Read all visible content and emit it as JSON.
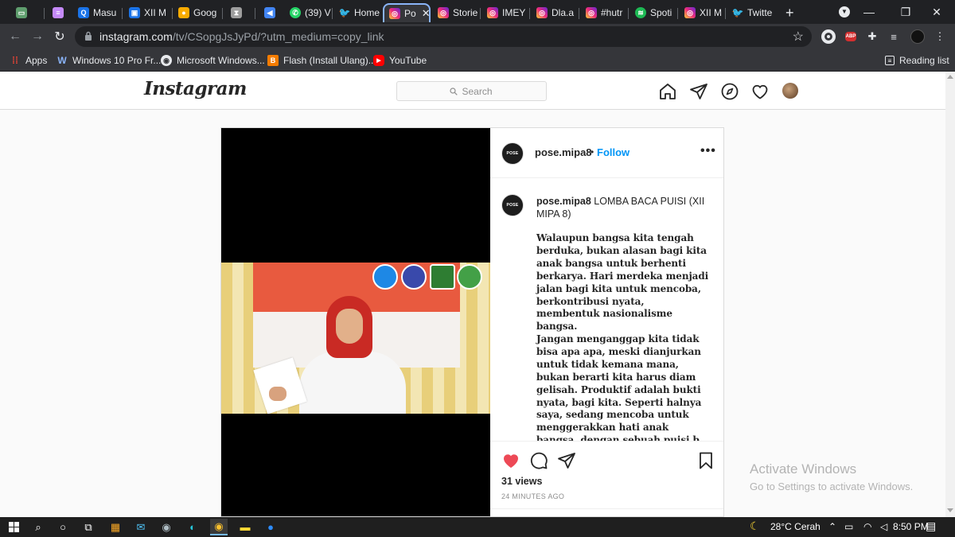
{
  "browser": {
    "tabs": [
      {
        "title": "",
        "icon": "terminal-icon",
        "color": "#5f9e6e"
      },
      {
        "title": "",
        "icon": "notes-icon",
        "color": "#c58af9"
      },
      {
        "title": "Masu",
        "icon": "q-icon",
        "color": "#1a73e8"
      },
      {
        "title": "XII M",
        "icon": "classroom-icon",
        "color": "#1a73e8"
      },
      {
        "title": "Goog",
        "icon": "keep-icon",
        "color": "#f9ab00"
      },
      {
        "title": "",
        "icon": "hourglass-icon",
        "color": "#9e9e9e"
      },
      {
        "title": "",
        "icon": "megaphone-icon",
        "color": "#4285f4"
      },
      {
        "title": "(39) V",
        "icon": "whatsapp-icon",
        "color": "#25d366"
      },
      {
        "title": "Home",
        "icon": "twitter-icon",
        "color": "#1d9bf0"
      },
      {
        "title": "Po",
        "icon": "instagram-icon",
        "color": "#e1306c",
        "active": true
      },
      {
        "title": "Storie",
        "icon": "instagram-icon",
        "color": "#e1306c"
      },
      {
        "title": "IMEY",
        "icon": "instagram-icon",
        "color": "#e1306c"
      },
      {
        "title": "Dla.a",
        "icon": "instagram-icon",
        "color": "#e1306c"
      },
      {
        "title": "#hutr",
        "icon": "instagram-icon",
        "color": "#e1306c"
      },
      {
        "title": "Spoti",
        "icon": "spotify-icon",
        "color": "#1db954"
      },
      {
        "title": "XII M",
        "icon": "instagram-icon",
        "color": "#e1306c"
      },
      {
        "title": "Twitte",
        "icon": "twitter-icon",
        "color": "#1d9bf0"
      }
    ],
    "new_tab": "+",
    "url_host": "instagram.com",
    "url_path": "/tv/CSopgJsJyPd/?utm_medium=copy_link",
    "abp_label": "ABP"
  },
  "bookmarks": [
    {
      "label": "Apps",
      "icon": "apps-grid-icon",
      "color": "#ea4335"
    },
    {
      "label": "Windows 10 Pro Fr...",
      "icon": "w-icon",
      "color": "#3b5998"
    },
    {
      "label": "Microsoft Windows...",
      "icon": "globe-icon",
      "color": "#e8eaed"
    },
    {
      "label": "Flash (Install Ulang)...",
      "icon": "blogger-icon",
      "color": "#f57c00"
    },
    {
      "label": "YouTube",
      "icon": "youtube-icon",
      "color": "#ff0000"
    }
  ],
  "reading_list": "Reading list",
  "instagram": {
    "logo": "Instagram",
    "search_placeholder": "Search",
    "post": {
      "username": "pose.mipa8",
      "follow": "Follow",
      "dot": "•",
      "avatar_text": "POSE",
      "caption_title": "LOMBA BACA PUISI (XII MIPA 8)",
      "paragraph1": "Walaupun bangsa kita tengah berduka, bukan alasan bagi kita anak bangsa untuk berhenti berkarya. Hari merdeka menjadi jalan bagi kita untuk mencoba, berkontribusi nyata, membentuk nasionalisme bangsa.",
      "paragraph2": "Jangan menganggap kita tidak bisa apa apa, meski dianjurkan untuk tidak kemana mana, bukan berarti kita harus diam gelisah. Produktif adalah bukti nyata, bagi kita. Seperti halnya saya, sedang mencoba untuk menggerakkan hati anak bangsa, dengan sebuah puisi b...",
      "views": "31 views",
      "time": "24 MINUTES AGO",
      "liked": true,
      "like_color": "#ed4956"
    }
  },
  "watermark": {
    "title": "Activate Windows",
    "subtitle": "Go to Settings to activate Windows."
  },
  "taskbar": {
    "weather": "28°C  Cerah",
    "time": "8:50 PM"
  }
}
